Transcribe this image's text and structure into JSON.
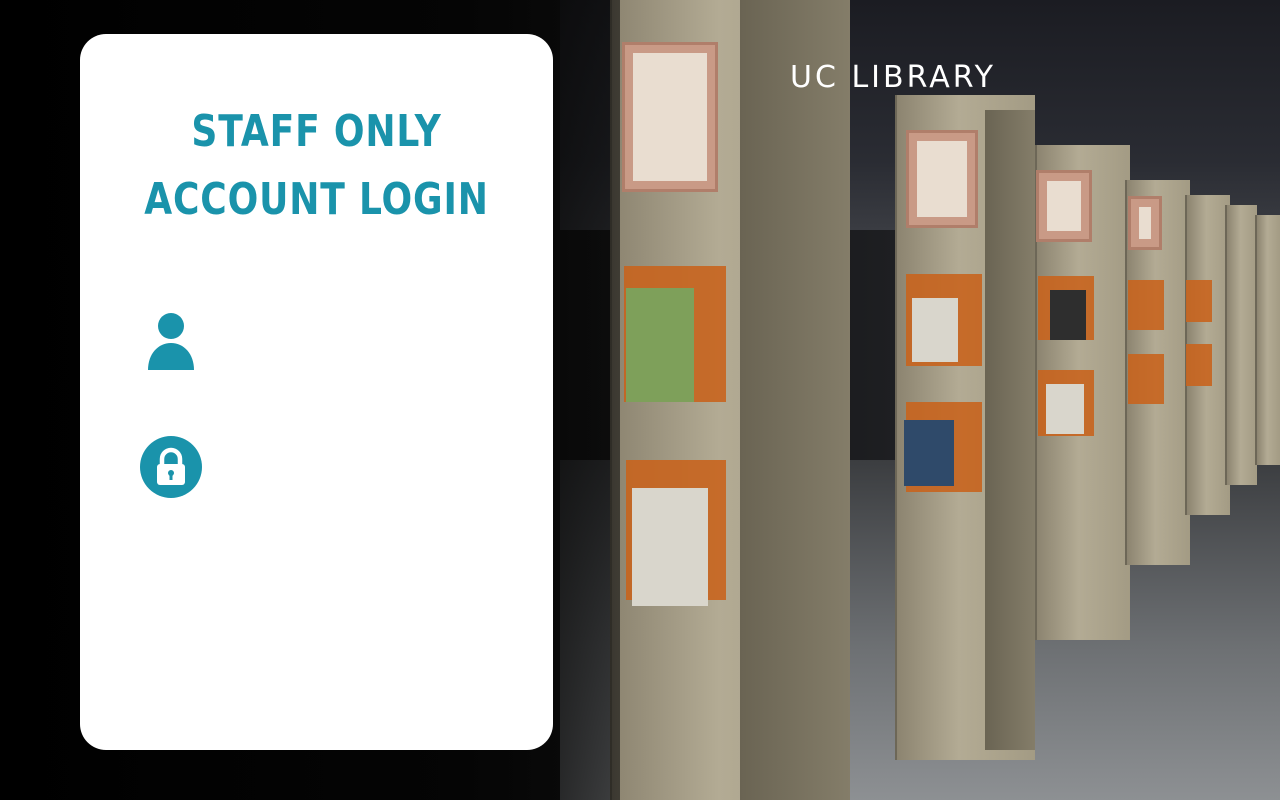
{
  "brand": {
    "name": "UC LIBRARY"
  },
  "login": {
    "title_line1": "STAFF ONLY",
    "title_line2": "ACCOUNT LOGIN",
    "username_placeholder": "",
    "password_placeholder": ""
  },
  "icons": {
    "username": "user-icon",
    "password": "lock-icon"
  },
  "colors": {
    "accent": "#1a93ab",
    "card": "#ffffff",
    "brand_text": "#ffffff"
  }
}
